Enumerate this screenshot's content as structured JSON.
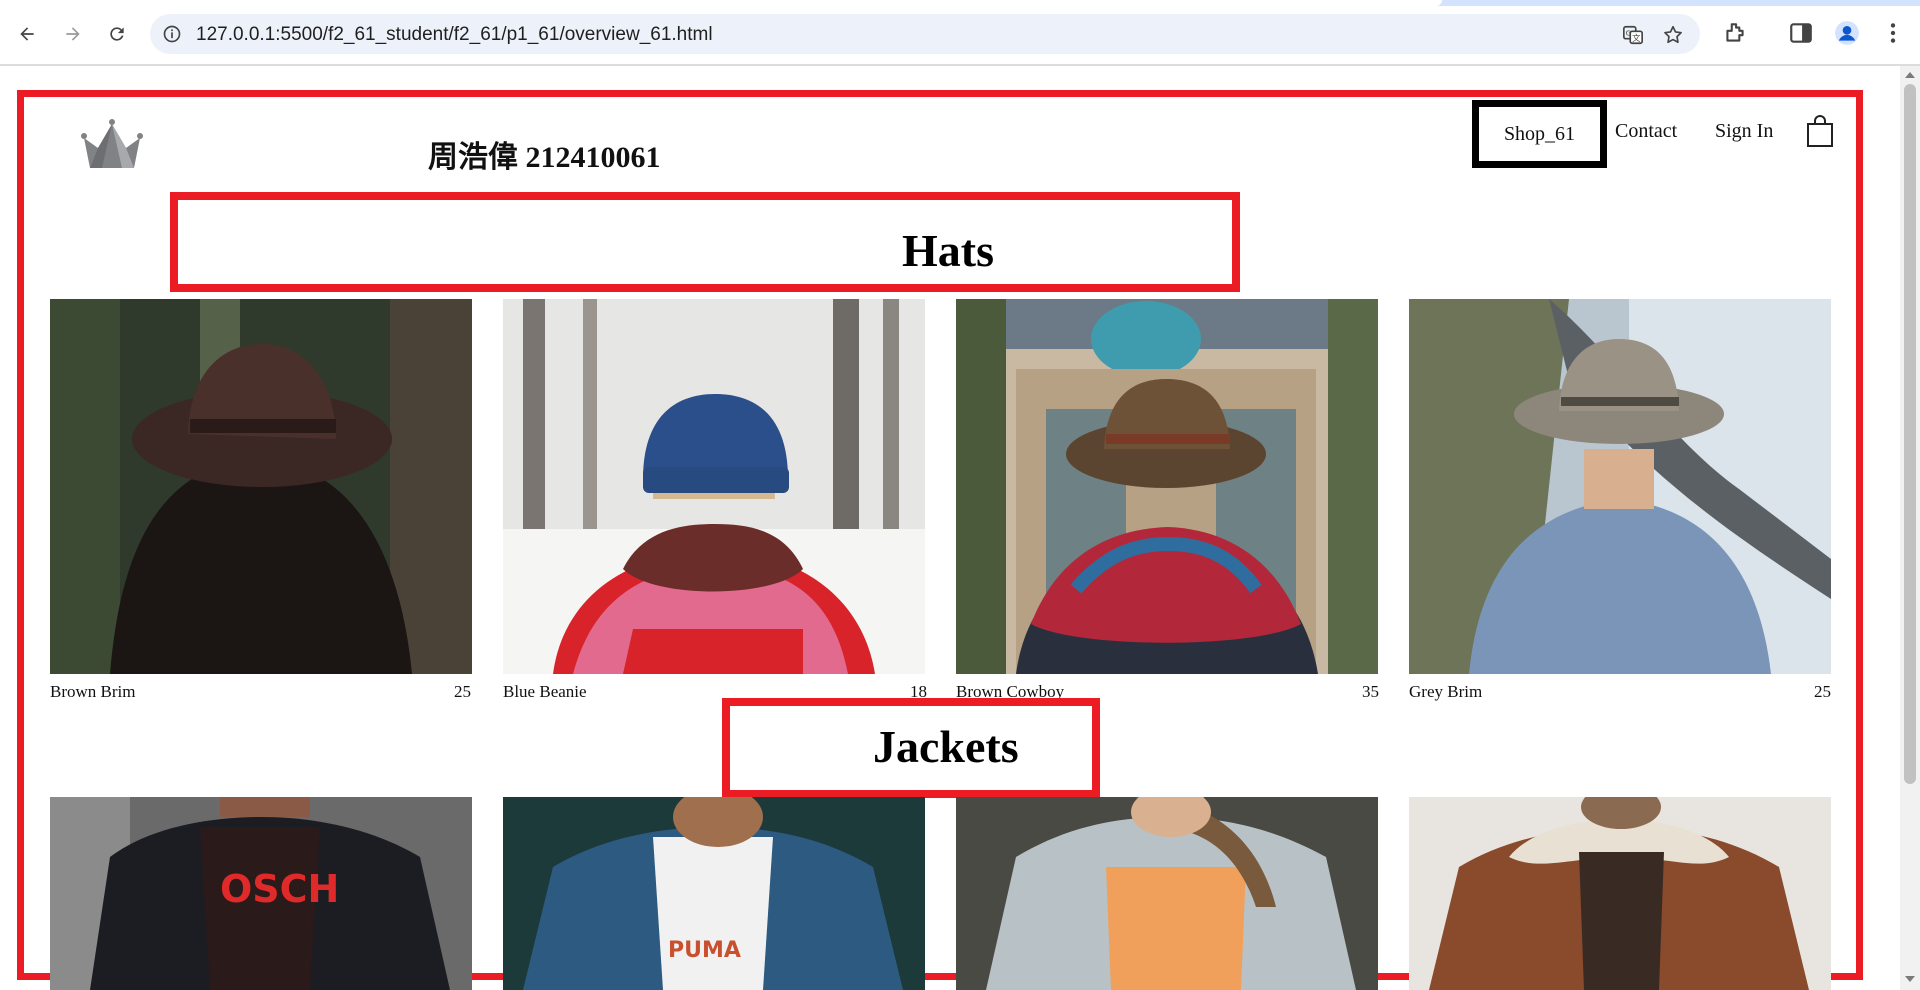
{
  "browser": {
    "url": "127.0.0.1:5500/f2_61_student/f2_61/p1_61/overview_61.html",
    "icons": [
      "back-arrow-icon",
      "forward-arrow-icon",
      "reload-icon",
      "site-info-icon",
      "translate-icon",
      "bookmark-star-icon",
      "extensions-icon",
      "side-panel-icon",
      "profile-icon",
      "kebab-menu-icon"
    ]
  },
  "header": {
    "student_id": "周浩偉 212410061",
    "logo": "crown-icon",
    "nav": {
      "shop": "Shop_61",
      "contact": "Contact",
      "sign_in": "Sign In",
      "cart": "shopping-bag-icon"
    }
  },
  "sections": [
    {
      "title": "Hats",
      "items": [
        {
          "name": "Brown Brim",
          "price": "25"
        },
        {
          "name": "Blue Beanie",
          "price": "18"
        },
        {
          "name": "Brown Cowboy",
          "price": "35"
        },
        {
          "name": "Grey Brim",
          "price": "25"
        }
      ]
    },
    {
      "title": "Jackets",
      "items": []
    }
  ],
  "colors": {
    "outline_red": "#ec1c24",
    "nav_active_border": "#000000"
  }
}
